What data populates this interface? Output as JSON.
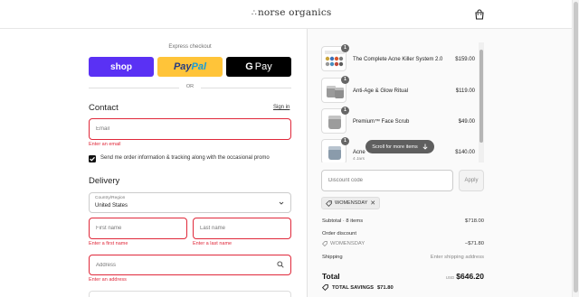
{
  "header": {
    "brand": "norse organics"
  },
  "express": {
    "label": "Express checkout",
    "shop": "shop",
    "paypal_pay": "Pay",
    "paypal_pal": "Pal",
    "gpay_g": "G",
    "gpay_pay": "Pay",
    "or": "OR"
  },
  "contact": {
    "title": "Contact",
    "signin": "Sign in",
    "email_placeholder": "Email",
    "email_error": "Enter an email",
    "marketing_label": "Send me order information & tracking along with the occasional promo"
  },
  "delivery": {
    "title": "Delivery",
    "country_label": "Country/Region",
    "country_value": "United States",
    "first_name_placeholder": "First name",
    "last_name_placeholder": "Last name",
    "first_name_error": "Enter a first name",
    "last_name_error": "Enter a last name",
    "address_placeholder": "Address",
    "address_error": "Enter an address"
  },
  "summary": {
    "items": [
      {
        "qty": "1",
        "name": "The Complete Acne Killer System 2.0",
        "price": "$159.00",
        "sub": ""
      },
      {
        "qty": "1",
        "name": "Anti-Age & Glow Ritual",
        "price": "$119.00",
        "sub": ""
      },
      {
        "qty": "1",
        "name": "Premium™ Face Scrub",
        "price": "$49.00",
        "sub": ""
      },
      {
        "qty": "1",
        "name": "Acne",
        "price": "$140.00",
        "sub": "4 Jars"
      }
    ],
    "scroll_toast": "Scroll for more items",
    "discount_placeholder": "Discount code",
    "apply": "Apply",
    "code_chip": "WOMENSDAY",
    "subtotal_label": "Subtotal · 8 items",
    "subtotal_value": "$718.00",
    "order_discount_label": "Order discount",
    "discount_code": "WOMENSDAY",
    "discount_value": "−$71.80",
    "shipping_label": "Shipping",
    "shipping_value": "Enter shipping address",
    "total_label": "Total",
    "currency": "USD",
    "total_value": "$646.20",
    "savings_label": "TOTAL SAVINGS",
    "savings_value": "$71.80"
  },
  "colors": {
    "shop": "#5a31f4",
    "paypal": "#ffc439",
    "gpay": "#000000",
    "error": "#e0283a"
  },
  "icons": [
    "cart-bag-icon",
    "chevron-down-icon",
    "search-icon",
    "check-icon",
    "tag-icon",
    "close-icon",
    "arrow-down-icon"
  ]
}
